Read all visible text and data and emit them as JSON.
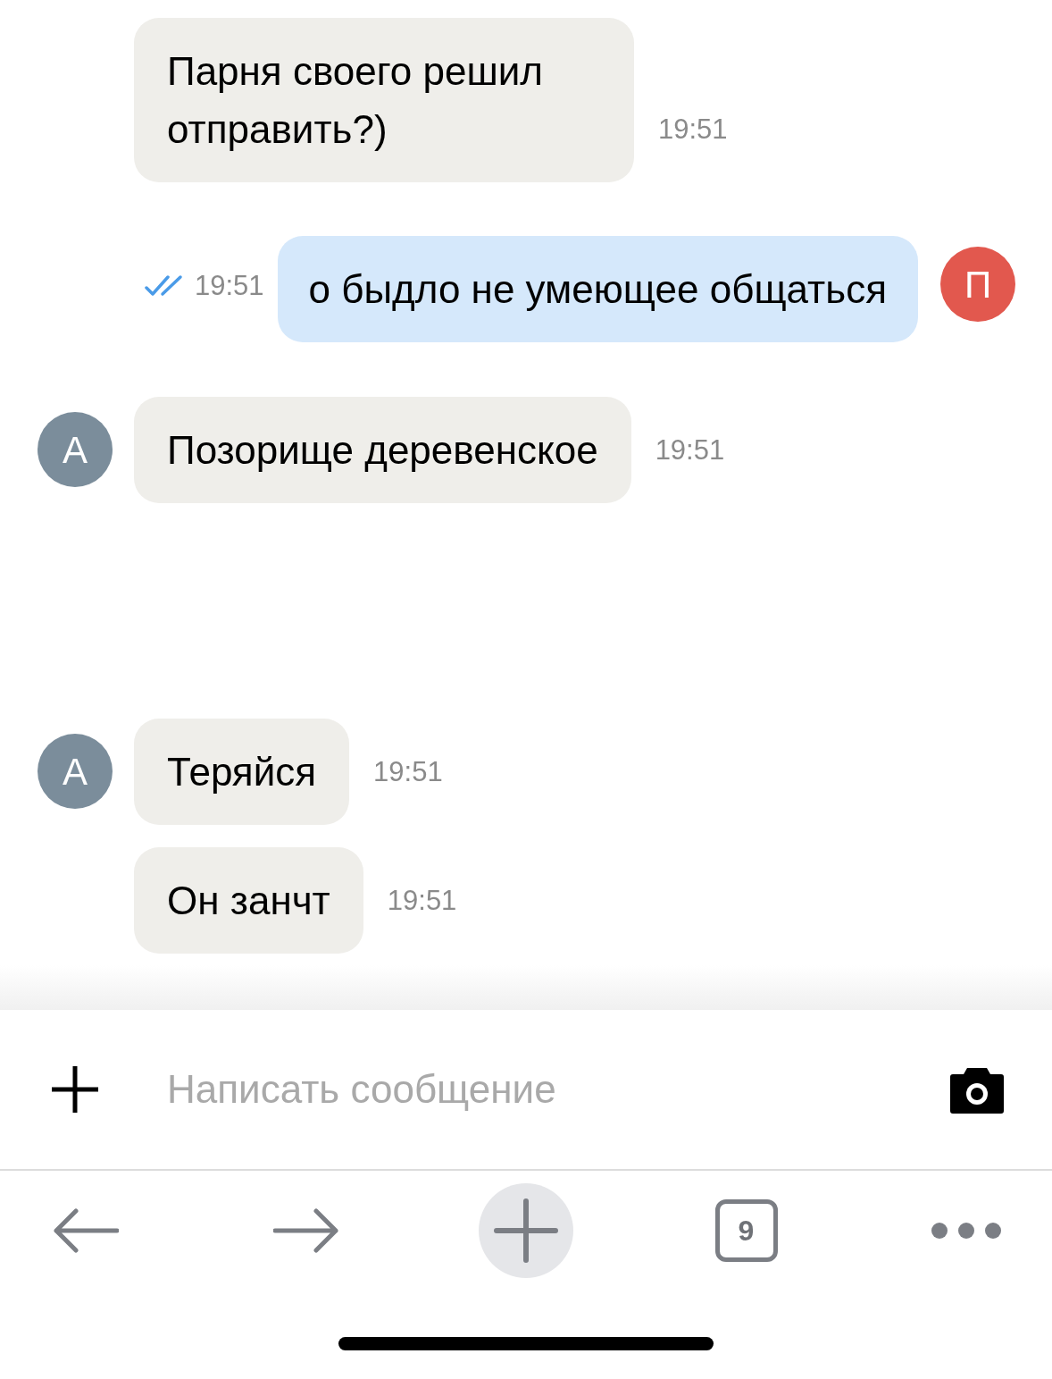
{
  "messages": [
    {
      "kind": "incoming",
      "text": "Парня своего решил отправить?)",
      "time": "19:51",
      "show_avatar": false
    },
    {
      "kind": "outgoing",
      "text": "о быдло не умеющее общаться",
      "time": "19:51",
      "read": true,
      "show_avatar": true,
      "avatar": "П",
      "color": "#e2584e"
    },
    {
      "kind": "incoming",
      "text": "Позорище деревенское",
      "time": "19:51",
      "show_avatar": true,
      "avatar": "А",
      "color": "#7b8d9b"
    },
    {
      "kind": "incoming",
      "text": "Теряйся",
      "time": "19:51",
      "show_avatar": true,
      "avatar": "А",
      "color": "#7b8d9b"
    },
    {
      "kind": "incoming",
      "text": "Он занчт",
      "time": "19:51",
      "show_avatar": false
    }
  ],
  "composer": {
    "placeholder": "Написать сообщение"
  },
  "browser_bar": {
    "tab_count": "9"
  }
}
